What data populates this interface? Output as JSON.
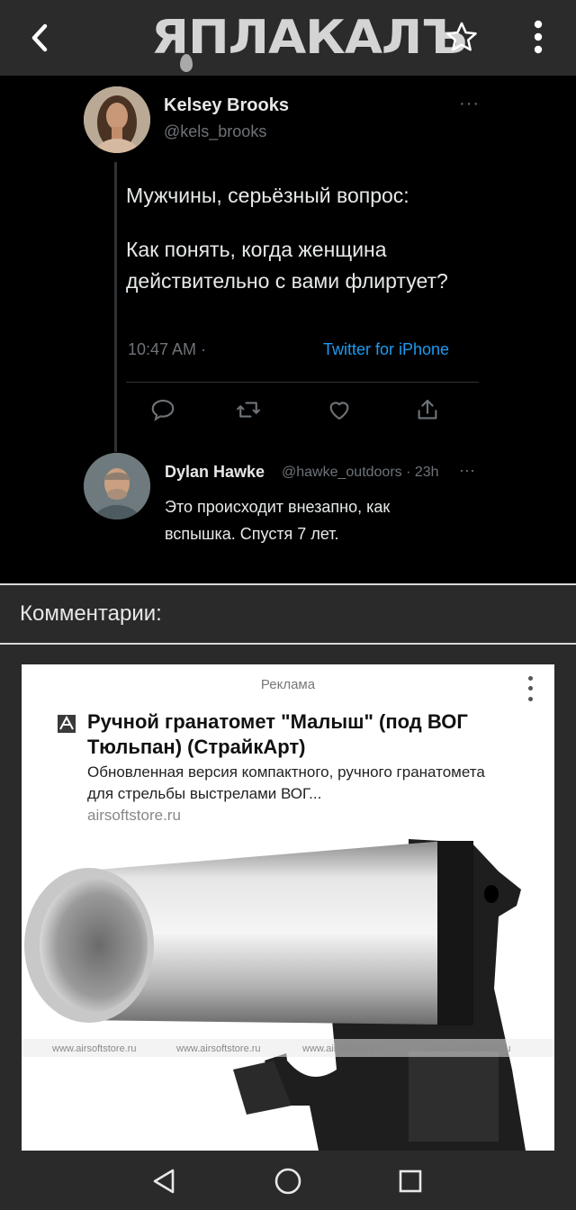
{
  "app": {
    "logo_text": "ЯПЛАКАЛЪ",
    "icons": {
      "back": "back-arrow-icon",
      "favorite": "star-icon",
      "menu": "kebab-menu-icon"
    }
  },
  "tweet": {
    "author_name": "Kelsey Brooks",
    "author_handle": "@kels_brooks",
    "more": "···",
    "question": "Мужчины, серьёзный вопрос:",
    "body": "Как понять, когда женщина действительно с вами флиртует?",
    "time": "10:47 AM ·",
    "source": "Twitter for iPhone",
    "actions": [
      "reply-icon",
      "retweet-icon",
      "like-icon",
      "share-icon"
    ]
  },
  "reply": {
    "author_name": "Dylan Hawke",
    "meta": "@hawke_outdoors · 23h",
    "more": "···",
    "text": "Это происходит внезапно, как вспышка. Спустя 7 лет."
  },
  "comments": {
    "title": "Комментарии:"
  },
  "ad": {
    "label": "Реклама",
    "title": "Ручной гранатомет \"Малыш\" (под ВОГ Тюльпан) (СтрайкАрт)",
    "description": "Обновленная версия компактного, ручного гранатомета для стрельбы выстрелами ВОГ...",
    "domain": "airsoftstore.ru",
    "watermarks": [
      "www.airsoftstore.ru",
      "www.airsoftstore.ru",
      "www.airsoftstore.ru",
      "www.airsoftstore.ru"
    ]
  },
  "navbar": {
    "icons": [
      "nav-back-icon",
      "nav-home-icon",
      "nav-recents-icon"
    ]
  },
  "colors": {
    "accent": "#1d9bf0",
    "bar": "#2b2b2b",
    "tweet_bg": "#000000"
  }
}
